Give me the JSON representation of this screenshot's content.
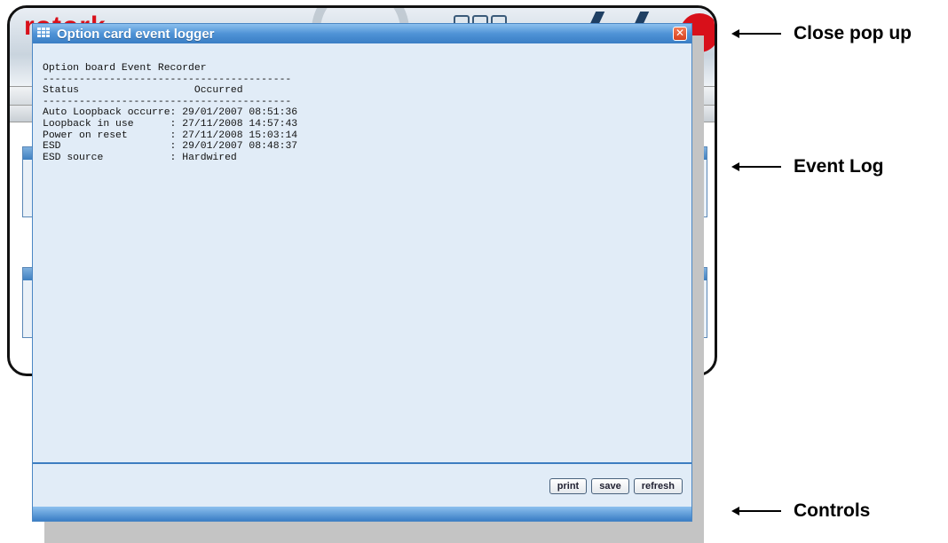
{
  "popup": {
    "title": "Option card event logger",
    "close_symbol": "✕",
    "log": {
      "heading": "Option board Event Recorder",
      "separator": "-----------------------------------------",
      "columns": {
        "status": "Status",
        "occurred": "Occurred"
      },
      "rows": [
        {
          "status": "Auto Loopback occurre",
          "occurred": "29/01/2007 08:51:36"
        },
        {
          "status": "Loopback in use",
          "occurred": "27/11/2008 14:57:43"
        },
        {
          "status": "Power on reset",
          "occurred": "27/11/2008 15:03:14"
        },
        {
          "status": "ESD",
          "occurred": "29/01/2007 08:48:37"
        },
        {
          "status": "ESD source",
          "occurred": "Hardwired"
        }
      ]
    },
    "controls": {
      "print": "print",
      "save": "save",
      "refresh": "refresh"
    }
  },
  "background": {
    "logo": "rotork"
  },
  "annotations": {
    "close": "Close pop up",
    "event_log": "Event Log",
    "controls": "Controls"
  },
  "colors": {
    "title_bar": "#4f93d6",
    "popup_bg": "#e1ecf7",
    "close_button": "#d8401d",
    "logo_red": "#d8101a"
  },
  "icons": {
    "title": "grid-icon",
    "close": "close-icon",
    "callout": "arrow-left-icon"
  }
}
